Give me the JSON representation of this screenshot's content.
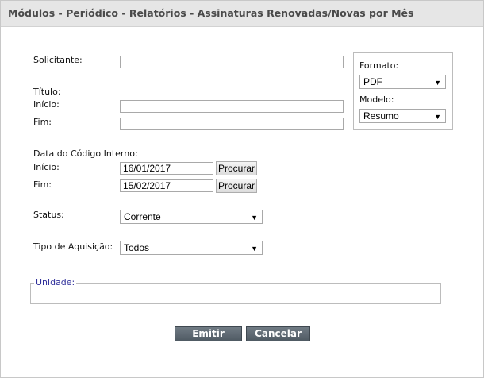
{
  "window": {
    "title": "Módulos - Periódico - Relatórios - Assinaturas Renovadas/Novas por Mês"
  },
  "form": {
    "solicitante_label": "Solicitante:",
    "solicitante_value": "",
    "titulo_label": "Título:",
    "titulo_inicio_label": "Início:",
    "titulo_inicio_value": "",
    "titulo_fim_label": "Fim:",
    "titulo_fim_value": "",
    "data_codigo_label": "Data do Código Interno:",
    "data_inicio_label": "Início:",
    "data_inicio_value": "16/01/2017",
    "data_fim_label": "Fim:",
    "data_fim_value": "15/02/2017",
    "procurar_label": "Procurar",
    "status_label": "Status:",
    "status_value": "Corrente",
    "tipo_aquisicao_label": "Tipo de Aquisição:",
    "tipo_aquisicao_value": "Todos",
    "unidade_legend": "Unidade:"
  },
  "options": {
    "formato_label": "Formato:",
    "formato_value": "PDF",
    "modelo_label": "Modelo:",
    "modelo_value": "Resumo"
  },
  "actions": {
    "emitir_label": "Emitir",
    "cancelar_label": "Cancelar"
  },
  "icons": {
    "dropdown": "chevron-down-icon"
  },
  "colors": {
    "titlebar_bg": "#e6e6e6",
    "legend_text": "#2f2f9a",
    "action_button_bg": "#5f6a73"
  }
}
